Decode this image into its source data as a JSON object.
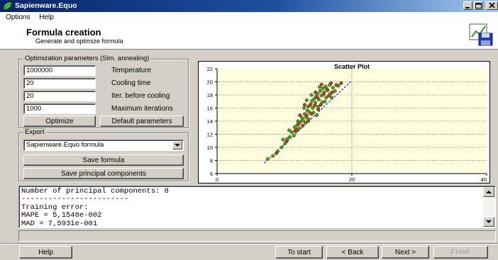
{
  "window": {
    "title": "Sapienware.Equo"
  },
  "menu": [
    "Options",
    "Help"
  ],
  "header": {
    "title": "Formula creation",
    "subtitle": "Generate and optimize formula"
  },
  "optimization": {
    "legend": "Optimization parameters (Sim. annealing)",
    "fields": [
      {
        "value": "1000000",
        "label": "Temperature"
      },
      {
        "value": "20",
        "label": "Cooling time"
      },
      {
        "value": "20",
        "label": "Iter. before cooling"
      },
      {
        "value": "1000",
        "label": "Maximum iterations"
      }
    ],
    "optimize_label": "Optimize",
    "default_label": "Default parameters"
  },
  "export": {
    "legend": "Export",
    "selected": "Sapienware.Equo formula",
    "save_formula_label": "Save formula",
    "save_components_label": "Save principal components"
  },
  "output_text": "Number of principal components: 8\n------------------------\nTraining error:\nMAPE = 5,1548e-002\nMAD = 7,5931e-001",
  "footer": {
    "help_label": "Help",
    "start_label": "To start",
    "back_label": "< Back",
    "next_label": "Next >",
    "finish_label": "Finish"
  },
  "colors": {
    "plot_bg": "#ffffe0",
    "point_green": "#44a51f",
    "point_red": "#c8342a",
    "fit_line": "#1b2fbf",
    "title_bar": "#0a246a"
  },
  "chart_data": {
    "type": "scatter",
    "title": "Scatter Plot",
    "xlim": [
      0,
      40
    ],
    "ylim": [
      6,
      22
    ],
    "x_ticks": [
      0,
      20,
      40
    ],
    "y_ticks": [
      6,
      8,
      10,
      12,
      14,
      16,
      18,
      20,
      22
    ],
    "grid": "dotted",
    "fit_line": {
      "x": [
        7,
        20
      ],
      "y": [
        7.6,
        20.2
      ]
    },
    "series": [
      {
        "color": "green",
        "points": [
          [
            7.5,
            8.2
          ],
          [
            8.3,
            8.7
          ],
          [
            9.0,
            9.4
          ],
          [
            9.6,
            10.0
          ],
          [
            10.1,
            10.6
          ],
          [
            10.4,
            11.3
          ],
          [
            10.8,
            11.6
          ],
          [
            11.1,
            12.3
          ],
          [
            11.4,
            11.8
          ],
          [
            11.7,
            12.8
          ],
          [
            11.9,
            13.4
          ],
          [
            12.2,
            12.9
          ],
          [
            12.4,
            13.9
          ],
          [
            12.6,
            14.5
          ],
          [
            12.8,
            14.1
          ],
          [
            13.0,
            15.1
          ],
          [
            13.2,
            14.6
          ],
          [
            13.4,
            15.6
          ],
          [
            13.5,
            16.2
          ],
          [
            13.7,
            15.4
          ],
          [
            13.9,
            16.6
          ],
          [
            14.1,
            17.1
          ],
          [
            14.2,
            16.0
          ],
          [
            14.4,
            17.4
          ],
          [
            14.6,
            16.8
          ],
          [
            14.7,
            17.8
          ],
          [
            14.9,
            18.2
          ],
          [
            15.1,
            17.3
          ],
          [
            15.3,
            18.6
          ],
          [
            15.5,
            17.9
          ],
          [
            15.7,
            19.0
          ],
          [
            15.9,
            18.4
          ],
          [
            16.1,
            19.3
          ],
          [
            16.4,
            18.7
          ],
          [
            16.7,
            19.5
          ],
          [
            17.2,
            19.1
          ],
          [
            18.0,
            19.4
          ],
          [
            13.1,
            13.7
          ],
          [
            12.0,
            14.0
          ],
          [
            13.6,
            14.3
          ],
          [
            14.3,
            15.3
          ],
          [
            15.0,
            16.2
          ],
          [
            15.6,
            16.9
          ],
          [
            16.2,
            17.6
          ],
          [
            16.8,
            18.2
          ],
          [
            17.5,
            18.6
          ],
          [
            11.5,
            13.1
          ],
          [
            12.9,
            16.0
          ],
          [
            14.0,
            18.0
          ],
          [
            15.2,
            19.2
          ],
          [
            10.7,
            12.6
          ],
          [
            9.8,
            11.2
          ],
          [
            16.0,
            17.0
          ],
          [
            17.0,
            17.6
          ],
          [
            13.3,
            17.2
          ],
          [
            14.8,
            14.9
          ]
        ]
      },
      {
        "color": "red",
        "points": [
          [
            8.8,
            9.1
          ],
          [
            10.3,
            10.9
          ],
          [
            11.6,
            12.5
          ],
          [
            12.1,
            13.6
          ],
          [
            12.7,
            13.3
          ],
          [
            13.3,
            14.9
          ],
          [
            13.8,
            16.4
          ],
          [
            14.0,
            15.1
          ],
          [
            14.5,
            16.4
          ],
          [
            14.9,
            17.6
          ],
          [
            15.4,
            16.5
          ],
          [
            15.8,
            18.1
          ],
          [
            16.3,
            18.9
          ],
          [
            16.6,
            17.9
          ],
          [
            17.1,
            18.4
          ],
          [
            17.7,
            19.5
          ],
          [
            18.4,
            19.8
          ],
          [
            12.3,
            14.9
          ],
          [
            13.0,
            16.5
          ],
          [
            14.6,
            18.4
          ],
          [
            15.5,
            19.6
          ],
          [
            16.9,
            19.8
          ],
          [
            11.9,
            12.6
          ],
          [
            13.5,
            14.0
          ],
          [
            15.0,
            15.8
          ]
        ]
      }
    ]
  }
}
